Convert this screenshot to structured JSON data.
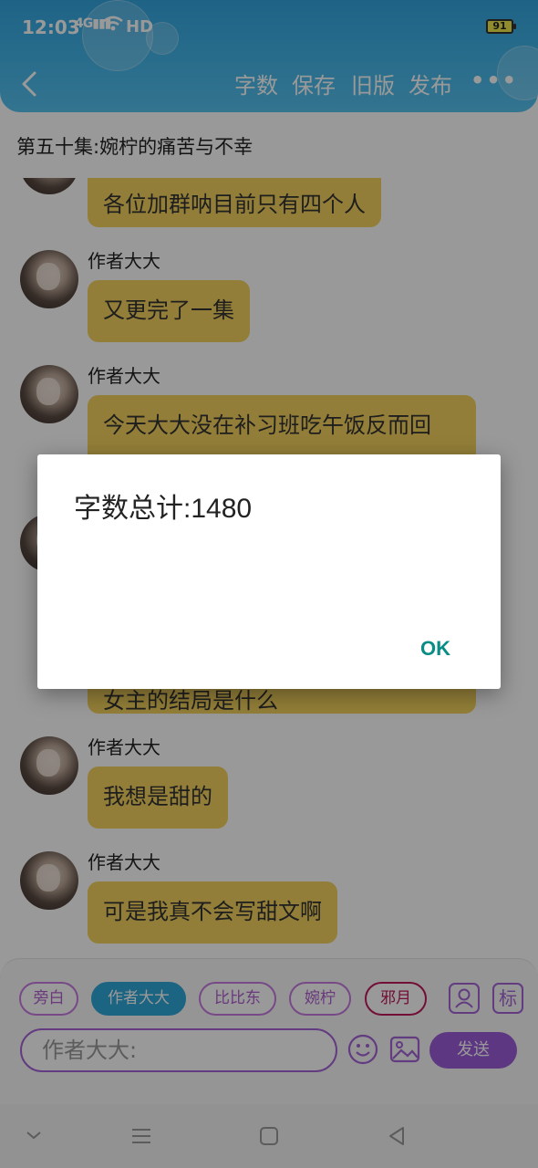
{
  "status_bar": {
    "time": "12:03",
    "signal": "4G",
    "network": "HD",
    "battery": "91"
  },
  "toolbar": {
    "back_icon": "chevron-left-icon",
    "items": [
      "字数",
      "保存",
      "旧版",
      "发布"
    ],
    "more_label": "•••"
  },
  "episode_title": "第五十集:婉柠的痛苦与不幸",
  "messages": [
    {
      "sender": "",
      "text": "各位加群呐目前只有四个人"
    },
    {
      "sender": "作者大大",
      "text": "又更完了一集"
    },
    {
      "sender": "作者大大",
      "text": "今天大大没在补习班吃午饭反而回"
    },
    {
      "sender": "",
      "text": "女主的结局是什么"
    },
    {
      "sender": "作者大大",
      "text": "我想是甜的"
    },
    {
      "sender": "作者大大",
      "text": "可是我真不会写甜文啊"
    }
  ],
  "roles": [
    "旁白",
    "作者大大",
    "比比东",
    "婉柠",
    "邪月"
  ],
  "role_buttons": {
    "person": "person-icon",
    "mark": "标"
  },
  "input": {
    "placeholder": "作者大大:"
  },
  "send_label": "发送",
  "dialog": {
    "title": "字数总计:1480",
    "ok_label": "OK"
  },
  "colors": {
    "header": "#45b6ea",
    "bubble": "#f4d35e",
    "accent_purple": "#9b5dd8",
    "active_role": "#2ea7d9",
    "ok_teal": "#0a8d85"
  }
}
